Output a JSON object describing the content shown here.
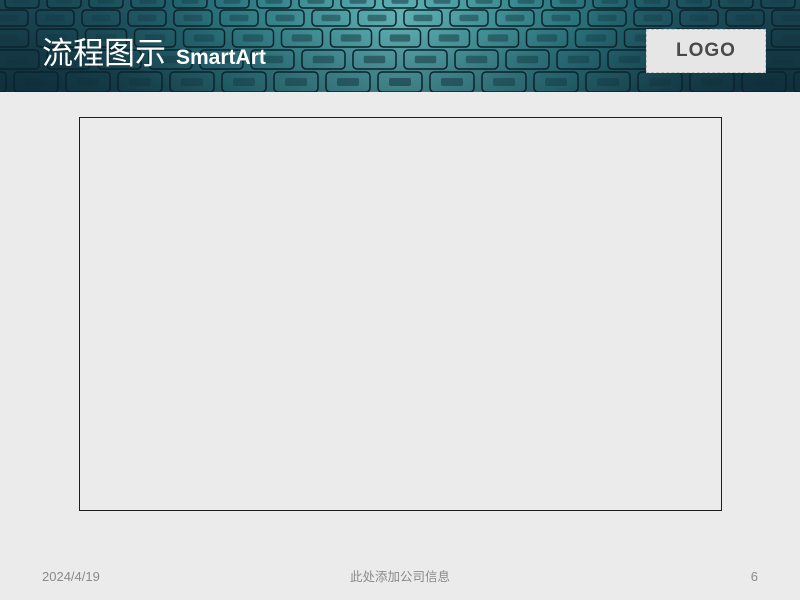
{
  "header": {
    "title_cn": "流程图示",
    "title_en": "SmartArt",
    "logo_label": "LOGO"
  },
  "footer": {
    "date": "2024/4/19",
    "company_info": "此处添加公司信息",
    "page_number": "6"
  },
  "colors": {
    "header_bg": "#0f2f3b",
    "header_glow": "#3cafaf",
    "slide_bg": "#ebebeb",
    "logo_bg": "#e6e6e6"
  }
}
